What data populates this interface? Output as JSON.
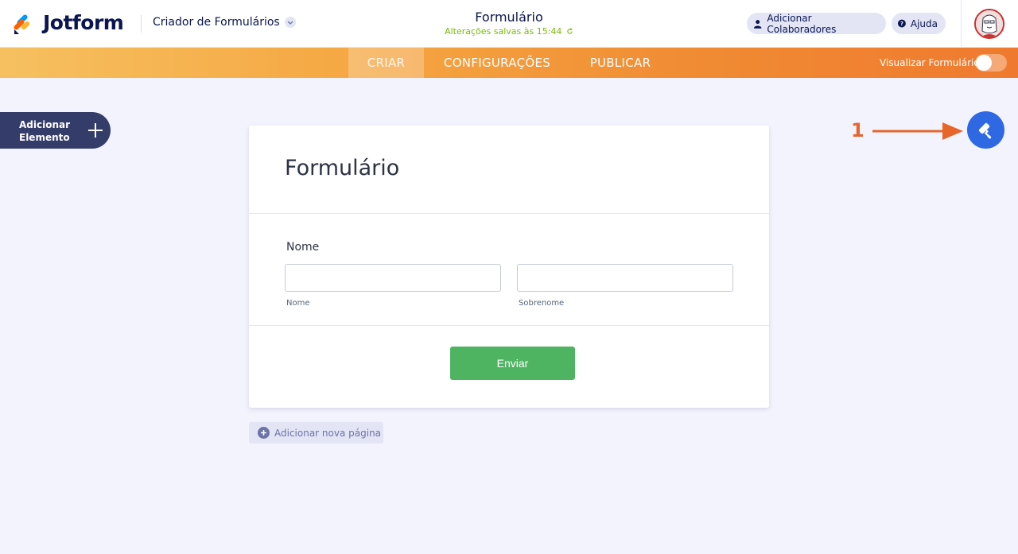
{
  "header": {
    "brand": "Jotform",
    "builder_title": "Criador de Formulários",
    "form_name": "Formulário",
    "save_status": "Alterações salvas às 15:44",
    "collaborators_label": "Adicionar Colaboradores",
    "help_label": "Ajuda"
  },
  "navbar": {
    "tabs": [
      "CRIAR",
      "CONFIGURAÇÕES",
      "PUBLICAR"
    ],
    "preview_label": "Visualizar Formulário",
    "preview_enabled": false
  },
  "sidebar": {
    "add_element_line1": "Adicionar",
    "add_element_line2": "Elemento"
  },
  "form": {
    "title": "Formulário",
    "field_label": "Nome",
    "first_name_sublabel": "Nome",
    "last_name_sublabel": "Sobrenome",
    "first_name_value": "",
    "last_name_value": "",
    "submit_label": "Enviar"
  },
  "add_page_label": "Adicionar nova página",
  "annotation": {
    "step_number": "1",
    "color": "#e8652a"
  },
  "colors": {
    "accent_blue": "#2e69e3",
    "submit_green": "#4fb462",
    "brand_navy": "#0a1551",
    "save_green": "#78bb07"
  },
  "icons": {
    "logo": "jotform-logo-icon",
    "chevron": "chevron-down-icon",
    "collaborators": "user-icon",
    "help": "question-icon",
    "refresh": "refresh-icon",
    "add": "plus-icon",
    "designer": "paint-roller-icon"
  }
}
